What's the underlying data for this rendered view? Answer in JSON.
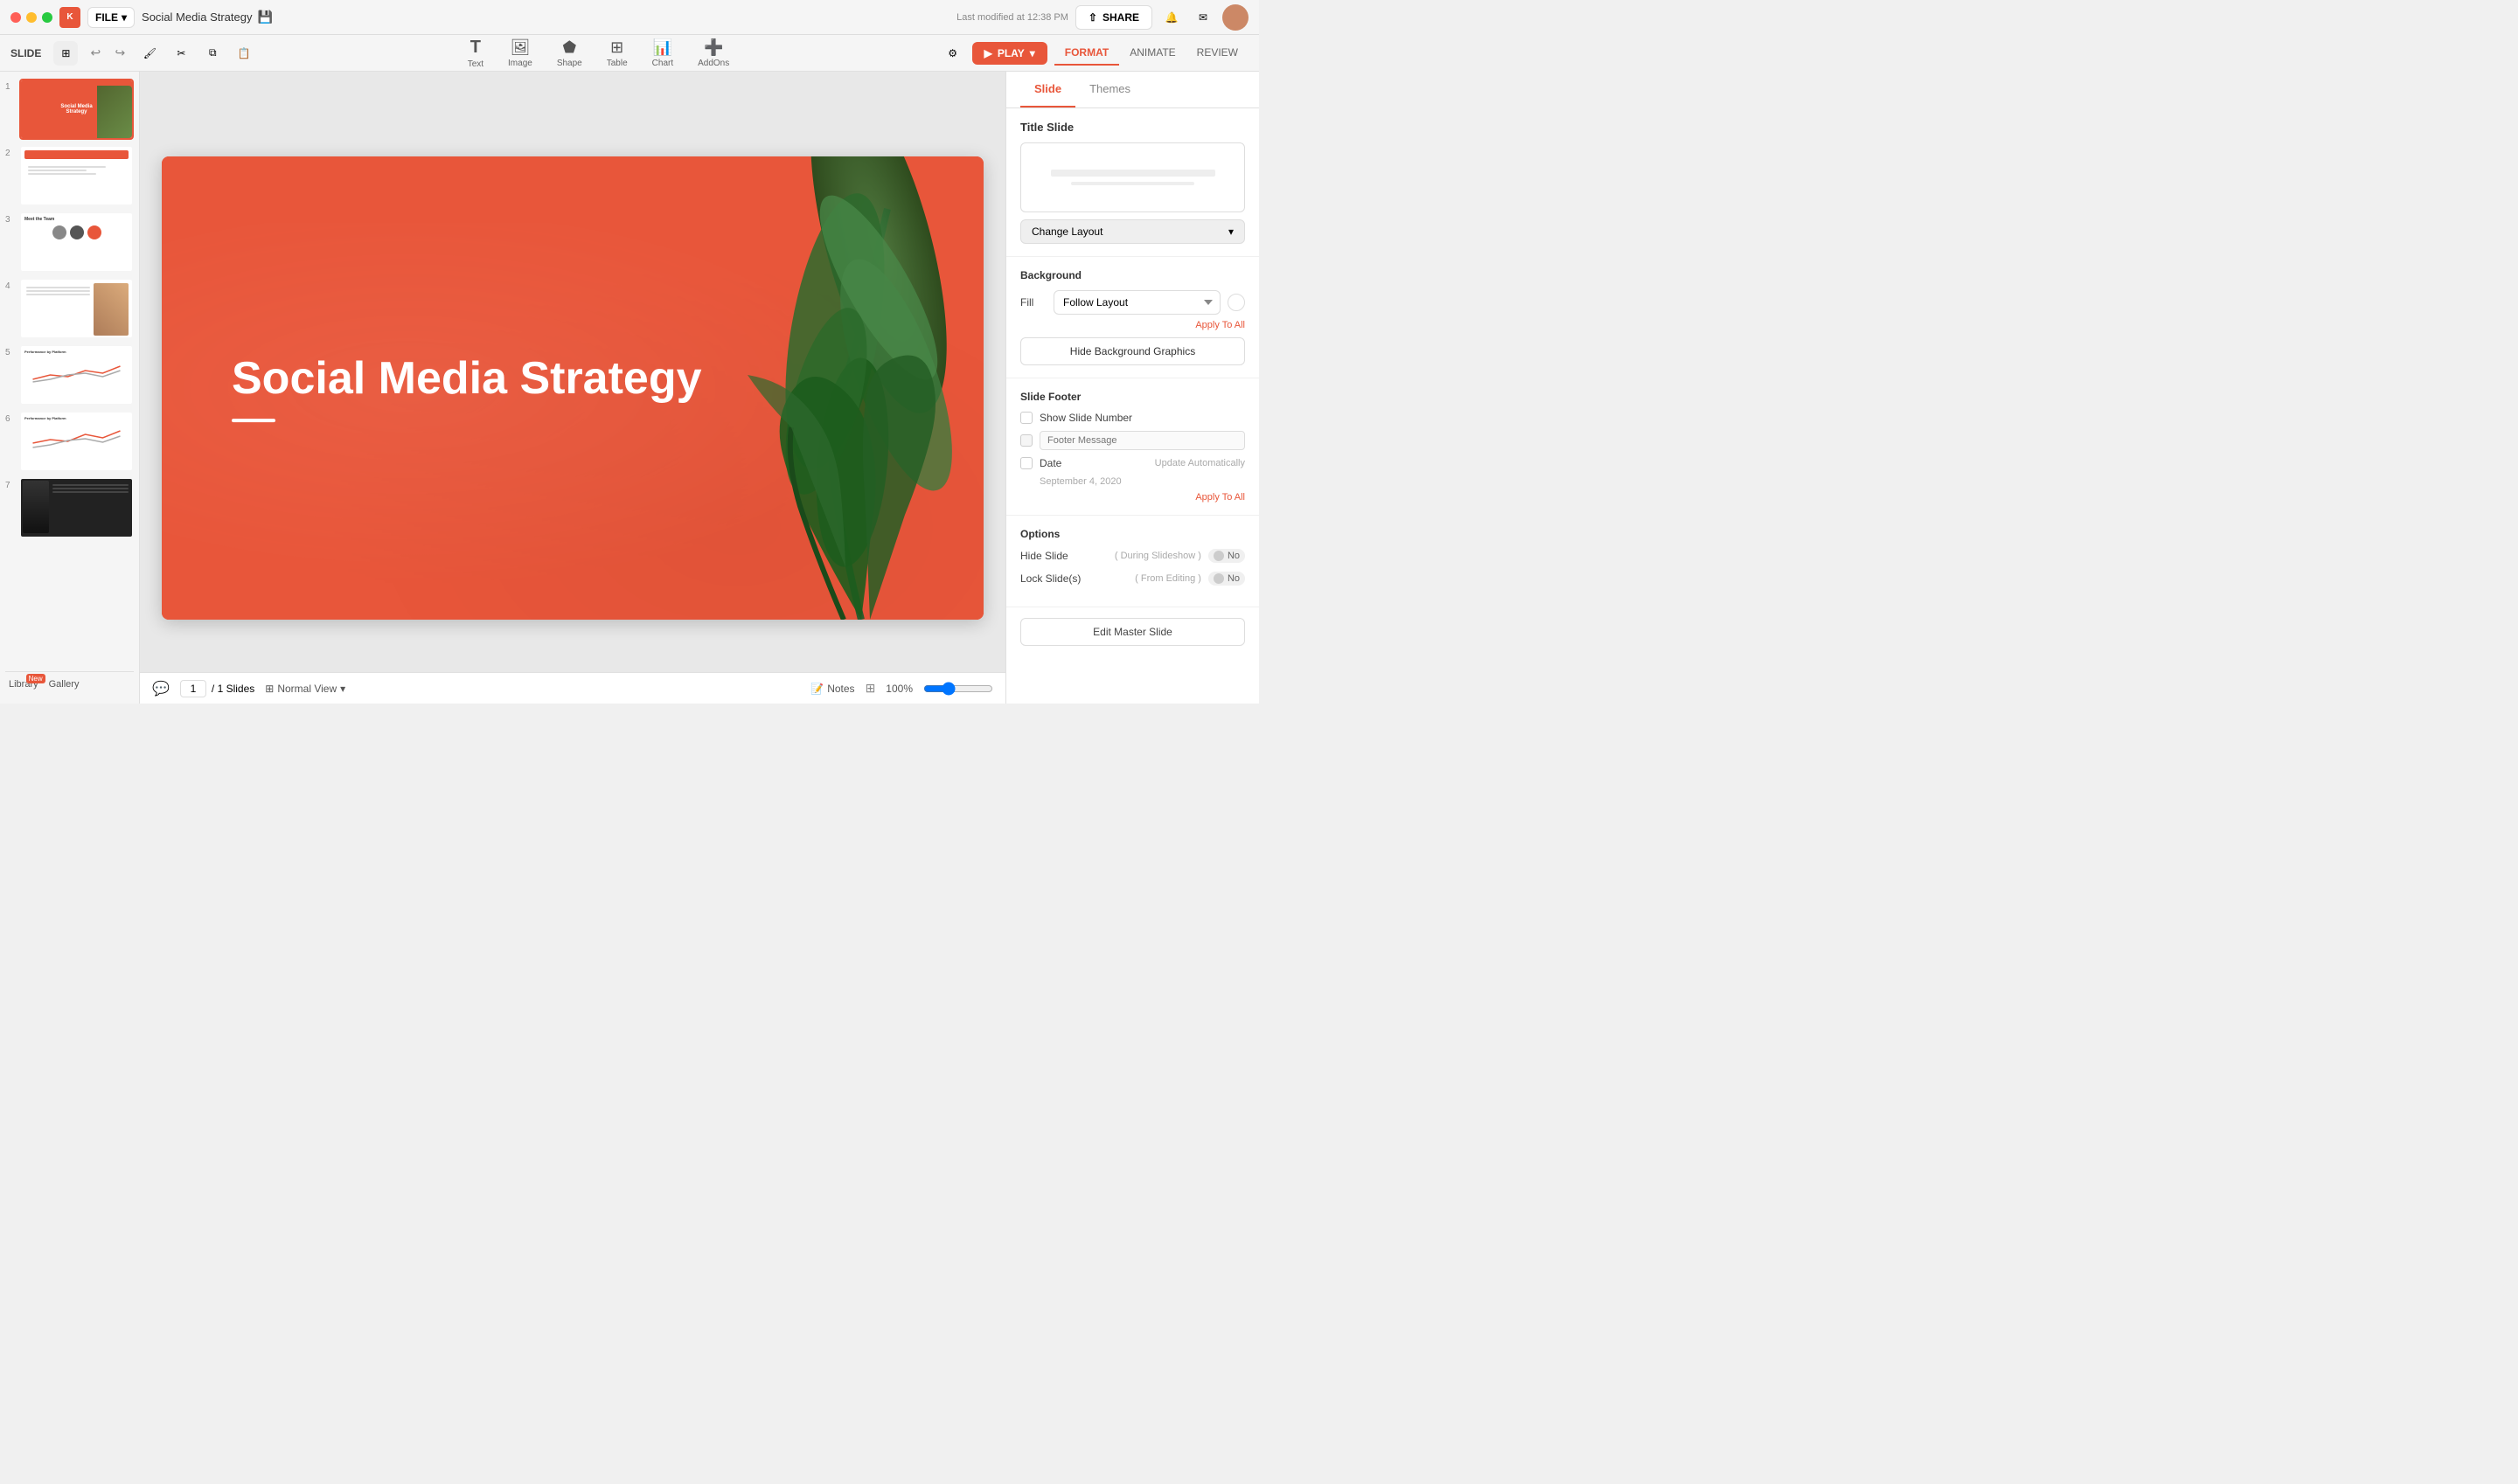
{
  "window": {
    "title": "Social Media Strategy"
  },
  "titlebar": {
    "file_label": "FILE",
    "doc_name": "Social Media Strategy",
    "last_modified": "Last modified at 12:38 PM",
    "share_label": "SHARE"
  },
  "toolbar": {
    "slide_label": "SLIDE",
    "undo_label": "↩",
    "redo_label": "↪",
    "play_label": "PLAY",
    "format_label": "FORMAT",
    "animate_label": "ANIMATE",
    "review_label": "REVIEW"
  },
  "tools": [
    {
      "icon": "T",
      "label": "Text"
    },
    {
      "icon": "🖼",
      "label": "Image"
    },
    {
      "icon": "⬟",
      "label": "Shape"
    },
    {
      "icon": "⊞",
      "label": "Table"
    },
    {
      "icon": "📊",
      "label": "Chart"
    },
    {
      "icon": "➕",
      "label": "AddOns"
    }
  ],
  "slide_panel": {
    "slides": [
      1,
      2,
      3,
      4,
      5,
      6,
      7
    ]
  },
  "slide": {
    "title": "Social Media Strategy",
    "bg_color": "#e8563a"
  },
  "right_panel": {
    "tabs": [
      "Slide",
      "Themes"
    ],
    "active_tab": "Slide",
    "layout_title": "Title Slide",
    "change_layout_label": "Change Layout",
    "background_title": "Background",
    "fill_label": "Fill",
    "follow_layout_label": "Follow Layout",
    "apply_to_all_label": "Apply To All",
    "hide_bg_graphics_label": "Hide Background Graphics",
    "footer_title": "Slide Footer",
    "show_slide_number_label": "Show Slide Number",
    "footer_message_label": "Footer Message",
    "footer_placeholder": "Footer Message",
    "date_label": "Date",
    "update_auto_label": "Update Automatically",
    "date_value": "September 4, 2020",
    "apply_to_all_footer_label": "Apply To All",
    "options_title": "Options",
    "hide_slide_label": "Hide Slide",
    "hide_slide_sub": "( During Slideshow )",
    "lock_slide_label": "Lock Slide(s)",
    "lock_slide_sub": "( From Editing )",
    "toggle_no": "No",
    "edit_master_label": "Edit Master Slide"
  },
  "bottom_bar": {
    "page_current": "1",
    "page_total": "/ 1 Slides",
    "view_label": "Normal View",
    "notes_label": "Notes",
    "zoom_level": "100%",
    "library_label": "Library",
    "gallery_label": "Gallery",
    "new_badge": "New"
  }
}
